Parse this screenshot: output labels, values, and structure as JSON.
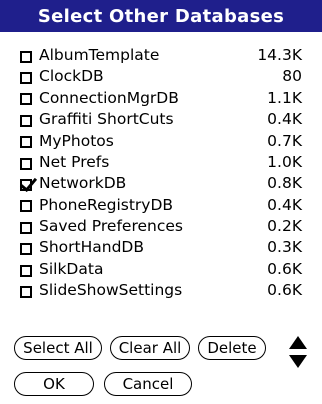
{
  "dialog": {
    "title": "Select Other Databases"
  },
  "databases": [
    {
      "name": "AlbumTemplate",
      "size": "14.3K",
      "checked": false
    },
    {
      "name": "ClockDB",
      "size": "80",
      "checked": false
    },
    {
      "name": "ConnectionMgrDB",
      "size": "1.1K",
      "checked": false
    },
    {
      "name": "Graffiti ShortCuts",
      "size": "0.4K",
      "checked": false
    },
    {
      "name": "MyPhotos",
      "size": "0.7K",
      "checked": false
    },
    {
      "name": "Net Prefs",
      "size": "1.0K",
      "checked": false
    },
    {
      "name": "NetworkDB",
      "size": "0.8K",
      "checked": true
    },
    {
      "name": "PhoneRegistryDB",
      "size": "0.4K",
      "checked": false
    },
    {
      "name": "Saved Preferences",
      "size": "0.2K",
      "checked": false
    },
    {
      "name": "ShortHandDB",
      "size": "0.3K",
      "checked": false
    },
    {
      "name": "SilkData",
      "size": "0.6K",
      "checked": false
    },
    {
      "name": "SlideShowSettings",
      "size": "0.6K",
      "checked": false
    }
  ],
  "buttons": {
    "select_all": "Select All",
    "clear_all": "Clear All",
    "delete": "Delete",
    "ok": "OK",
    "cancel": "Cancel"
  },
  "icons": {
    "scroll": "scroll-arrows-icon"
  },
  "colors": {
    "titlebar": "#1f1f8c"
  }
}
